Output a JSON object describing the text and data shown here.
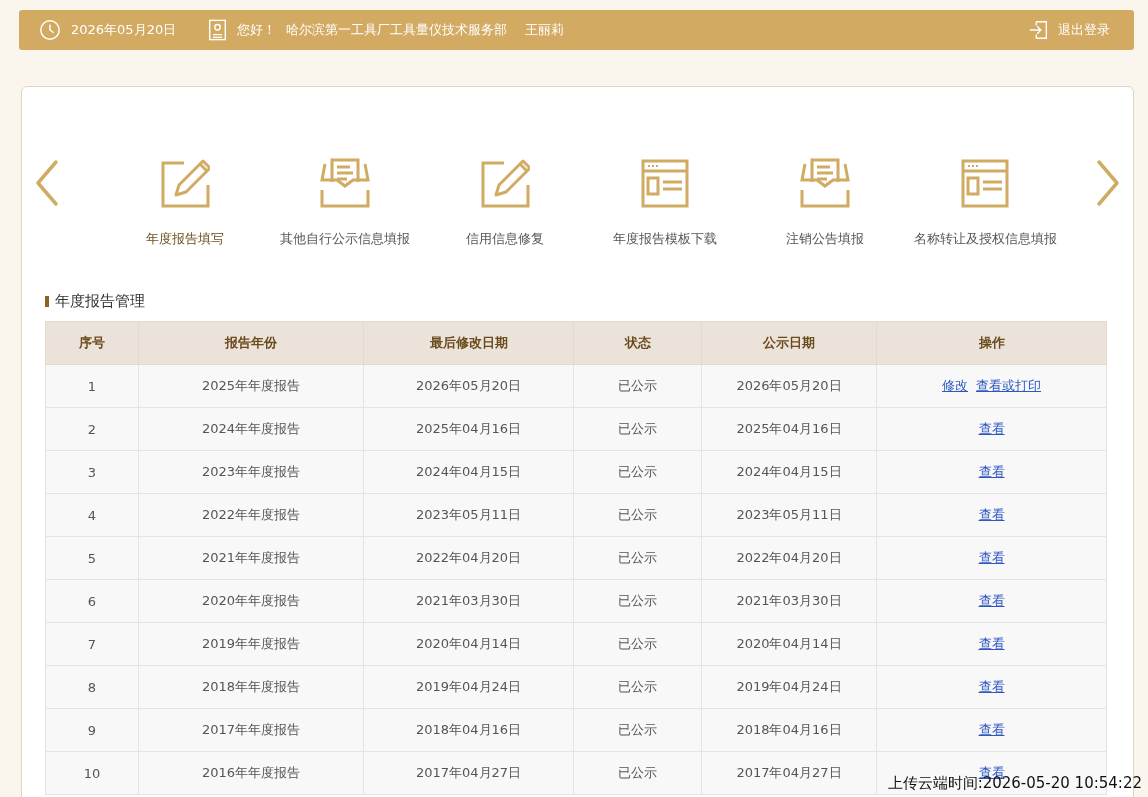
{
  "header": {
    "date": "2026年05月20日",
    "greeting": "您好！",
    "org": "哈尔滨第一工具厂工具量仪技术服务部",
    "user": "王丽莉",
    "logout": "退出登录"
  },
  "shortcuts": [
    {
      "label": "年度报告填写",
      "kind": "edit",
      "selected": true
    },
    {
      "label": "其他自行公示信息填报",
      "kind": "tray",
      "selected": false
    },
    {
      "label": "信用信息修复",
      "kind": "edit",
      "selected": false
    },
    {
      "label": "年度报告模板下载",
      "kind": "form",
      "selected": false
    },
    {
      "label": "注销公告填报",
      "kind": "tray",
      "selected": false
    },
    {
      "label": "名称转让及授权信息填报",
      "kind": "form",
      "selected": false
    }
  ],
  "section_title": "年度报告管理",
  "table": {
    "columns": [
      "序号",
      "报告年份",
      "最后修改日期",
      "状态",
      "公示日期",
      "操作"
    ],
    "rows": [
      {
        "cells": [
          "1",
          "2025年年度报告",
          "2026年05月20日",
          "已公示",
          "2026年05月20日"
        ],
        "actions": [
          "修改",
          "查看或打印"
        ]
      },
      {
        "cells": [
          "2",
          "2024年年度报告",
          "2025年04月16日",
          "已公示",
          "2025年04月16日"
        ],
        "actions": [
          "查看"
        ]
      },
      {
        "cells": [
          "3",
          "2023年年度报告",
          "2024年04月15日",
          "已公示",
          "2024年04月15日"
        ],
        "actions": [
          "查看"
        ]
      },
      {
        "cells": [
          "4",
          "2022年年度报告",
          "2023年05月11日",
          "已公示",
          "2023年05月11日"
        ],
        "actions": [
          "查看"
        ]
      },
      {
        "cells": [
          "5",
          "2021年年度报告",
          "2022年04月20日",
          "已公示",
          "2022年04月20日"
        ],
        "actions": [
          "查看"
        ]
      },
      {
        "cells": [
          "6",
          "2020年年度报告",
          "2021年03月30日",
          "已公示",
          "2021年03月30日"
        ],
        "actions": [
          "查看"
        ]
      },
      {
        "cells": [
          "7",
          "2019年年度报告",
          "2020年04月14日",
          "已公示",
          "2020年04月14日"
        ],
        "actions": [
          "查看"
        ]
      },
      {
        "cells": [
          "8",
          "2018年年度报告",
          "2019年04月24日",
          "已公示",
          "2019年04月24日"
        ],
        "actions": [
          "查看"
        ]
      },
      {
        "cells": [
          "9",
          "2017年年度报告",
          "2018年04月16日",
          "已公示",
          "2018年04月16日"
        ],
        "actions": [
          "查看"
        ]
      },
      {
        "cells": [
          "10",
          "2016年年度报告",
          "2017年04月27日",
          "已公示",
          "2017年04月27日"
        ],
        "actions": [
          "查看"
        ]
      }
    ]
  },
  "upload_time": "上传云端时间:2026-05-20 10:54:22"
}
